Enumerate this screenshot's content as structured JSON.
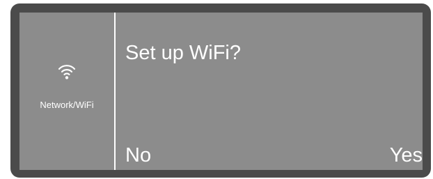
{
  "sidebar": {
    "icon": "wifi-icon",
    "label": "Network/WiFi"
  },
  "dialog": {
    "prompt": "Set up WiFi?",
    "no_label": "No",
    "yes_label": "Yes"
  },
  "colors": {
    "bezel": "#4b4b4b",
    "screen": "#8c8c8c",
    "text": "#ffffff"
  }
}
